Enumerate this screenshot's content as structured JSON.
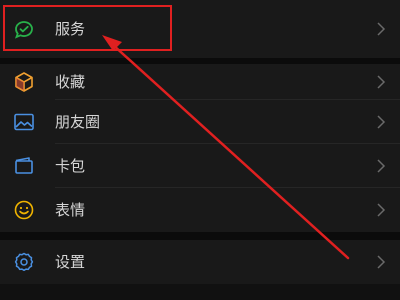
{
  "menu": {
    "items": [
      {
        "label": "服务",
        "icon": "service-check-icon",
        "icon_color": "#28b04a"
      },
      {
        "label": "收藏",
        "icon": "favorites-cube-icon",
        "icon_color": "#f0a030"
      },
      {
        "label": "朋友圈",
        "icon": "moments-image-icon",
        "icon_color": "#4a90e2"
      },
      {
        "label": "卡包",
        "icon": "card-wallet-icon",
        "icon_color": "#4a90e2"
      },
      {
        "label": "表情",
        "icon": "emoji-smile-icon",
        "icon_color": "#f0b400"
      },
      {
        "label": "设置",
        "icon": "settings-gear-icon",
        "icon_color": "#4a90e2"
      }
    ]
  },
  "annotation": {
    "highlight_color": "#e02020",
    "highlighted_item": "服务"
  }
}
